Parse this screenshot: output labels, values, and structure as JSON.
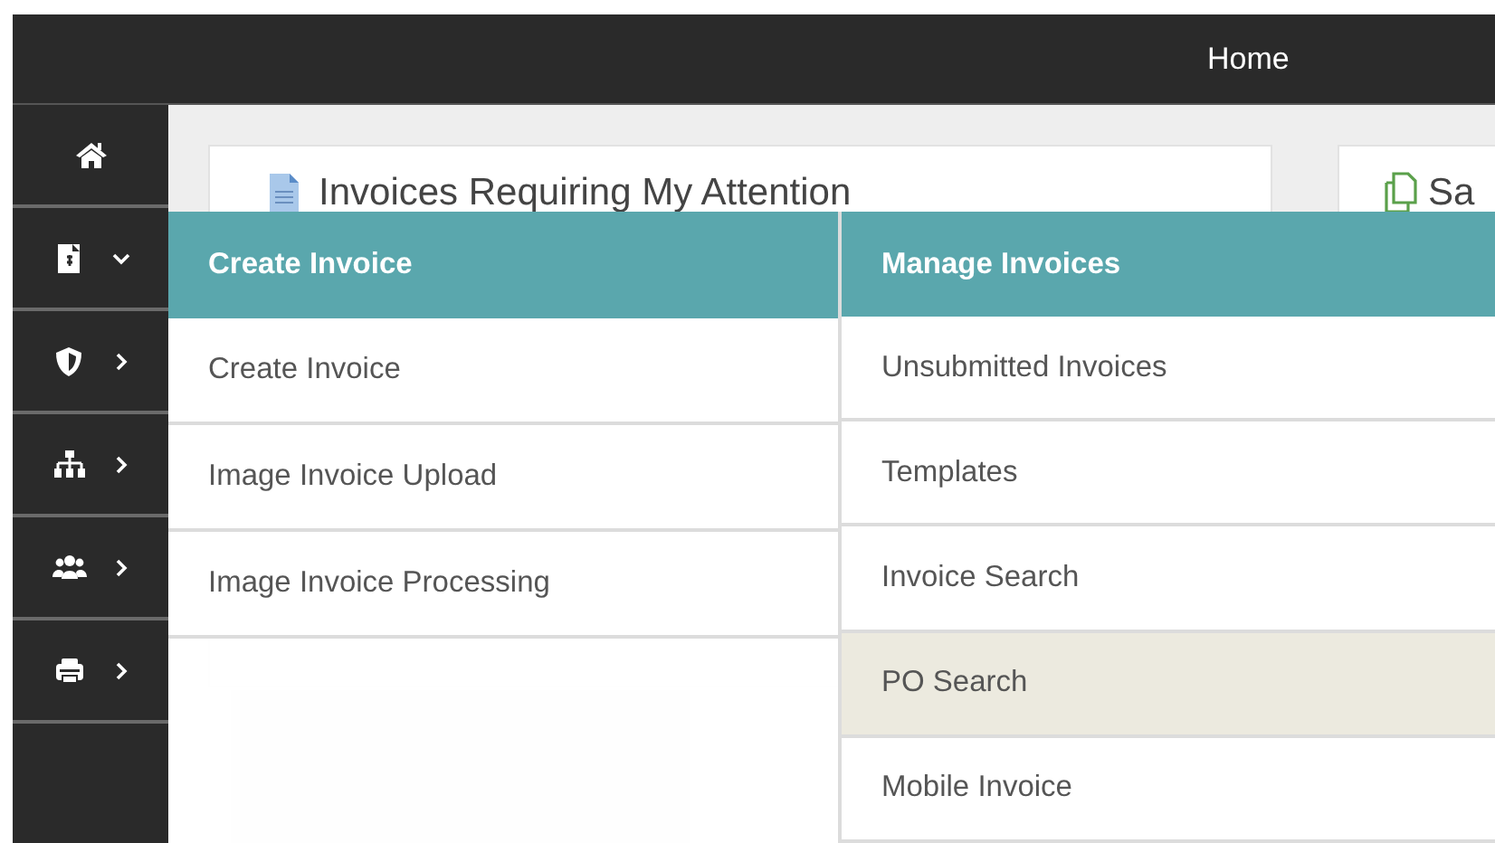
{
  "header": {
    "title": "Home"
  },
  "sidebar": {
    "items": [
      {
        "expanded": true
      },
      {
        "expanded": false
      },
      {
        "expanded": false
      },
      {
        "expanded": false
      },
      {
        "expanded": false
      }
    ]
  },
  "cards": [
    {
      "title": "Invoices Requiring My Attention"
    },
    {
      "title": "Sa"
    }
  ],
  "mega_menu": {
    "columns": [
      {
        "heading": "Create Invoice",
        "items": [
          {
            "label": "Create Invoice",
            "highlighted": false
          },
          {
            "label": "Image Invoice Upload",
            "highlighted": false
          },
          {
            "label": "Image Invoice Processing",
            "highlighted": false
          }
        ]
      },
      {
        "heading": "Manage Invoices",
        "items": [
          {
            "label": "Unsubmitted Invoices",
            "highlighted": false
          },
          {
            "label": "Templates",
            "highlighted": false
          },
          {
            "label": "Invoice Search",
            "highlighted": false
          },
          {
            "label": "PO Search",
            "highlighted": true
          },
          {
            "label": "Mobile Invoice",
            "highlighted": false
          }
        ]
      }
    ]
  }
}
